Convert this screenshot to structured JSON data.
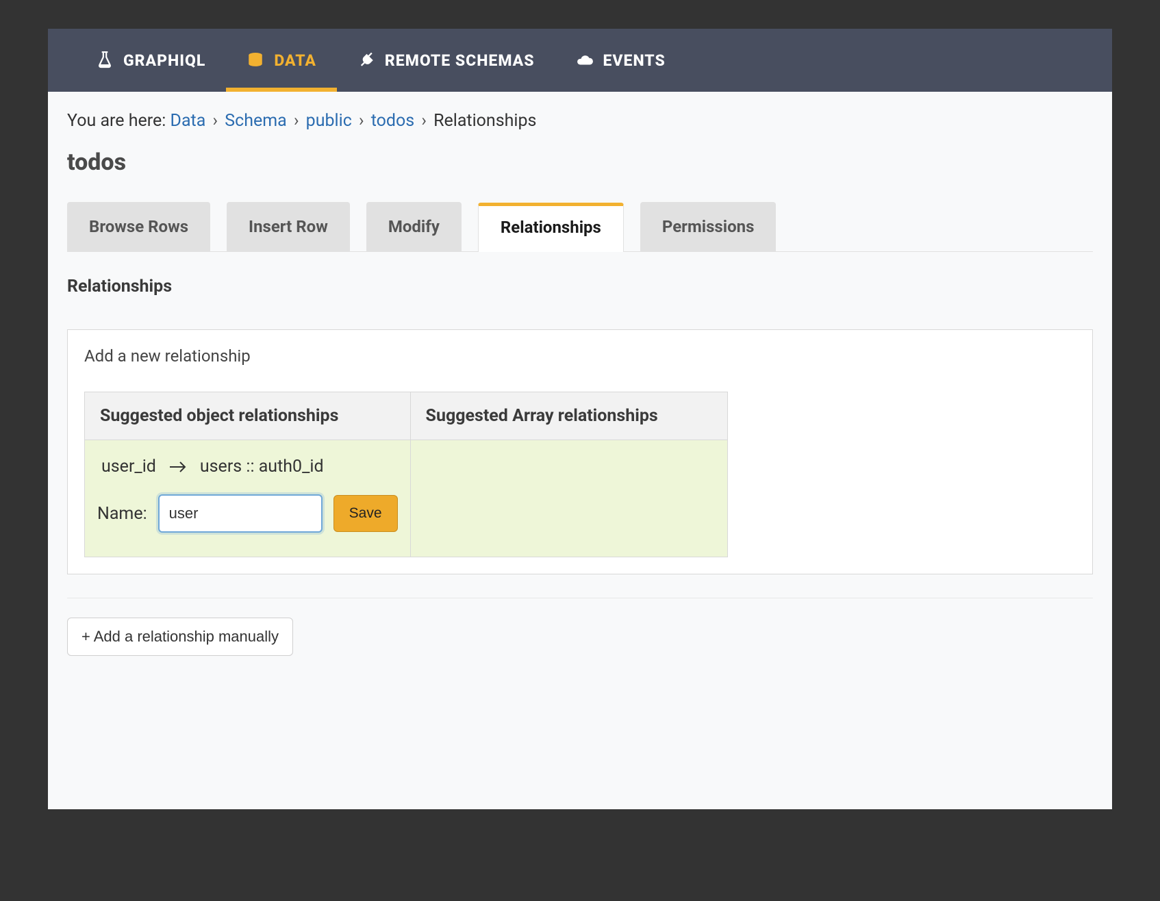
{
  "topnav": {
    "items": [
      {
        "label": "GRAPHIQL",
        "active": false
      },
      {
        "label": "DATA",
        "active": true
      },
      {
        "label": "REMOTE SCHEMAS",
        "active": false
      },
      {
        "label": "EVENTS",
        "active": false
      }
    ]
  },
  "breadcrumb": {
    "prefix": "You are here: ",
    "links": [
      "Data",
      "Schema",
      "public",
      "todos"
    ],
    "current": "Relationships",
    "sep": "›"
  },
  "page_title": "todos",
  "tabs": [
    {
      "label": "Browse Rows",
      "active": false
    },
    {
      "label": "Insert Row",
      "active": false
    },
    {
      "label": "Modify",
      "active": false
    },
    {
      "label": "Relationships",
      "active": true
    },
    {
      "label": "Permissions",
      "active": false
    }
  ],
  "section_title": "Relationships",
  "panel": {
    "label": "Add a new relationship",
    "object_header": "Suggested object relationships",
    "array_header": "Suggested Array relationships",
    "suggestion": {
      "from": "user_id",
      "to": "users :: auth0_id",
      "name_label": "Name:",
      "name_value": "user",
      "save_label": "Save"
    }
  },
  "manual_button": "+ Add a relationship manually"
}
